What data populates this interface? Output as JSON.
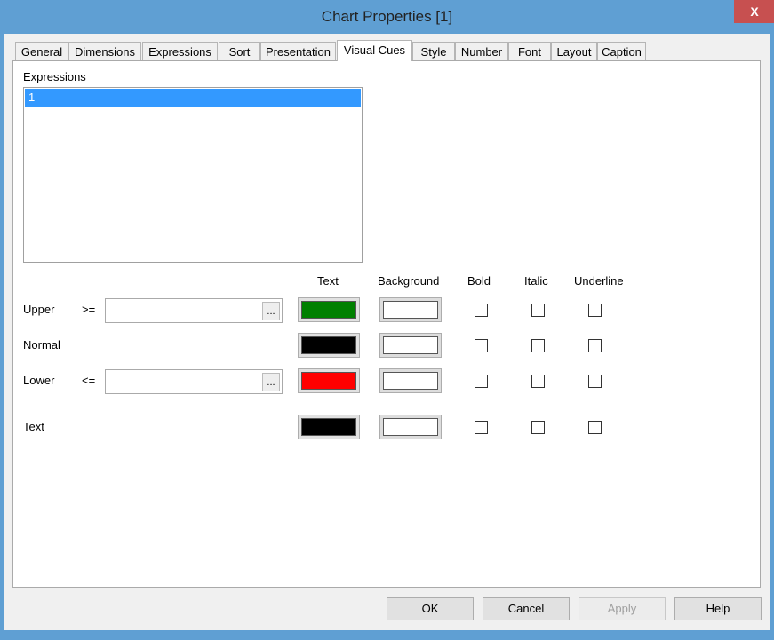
{
  "window": {
    "title": "Chart Properties [1]",
    "close": "X"
  },
  "tabs": [
    "General",
    "Dimensions",
    "Expressions",
    "Sort",
    "Presentation",
    "Visual Cues",
    "Style",
    "Number",
    "Font",
    "Layout",
    "Caption"
  ],
  "selected_tab": "Visual Cues",
  "expressions": {
    "label": "Expressions",
    "items": [
      "1"
    ]
  },
  "columns": {
    "text": "Text",
    "background": "Background",
    "bold": "Bold",
    "italic": "Italic",
    "underline": "Underline"
  },
  "rows": [
    {
      "label": "Upper",
      "op": ">=",
      "value": "",
      "browse": "...",
      "text_color": "#008000",
      "bg_color": "#ffffff",
      "bold": false,
      "italic": false,
      "underline": false
    },
    {
      "label": "Normal",
      "text_color": "#000000",
      "bg_color": "#ffffff",
      "bold": false,
      "italic": false,
      "underline": false
    },
    {
      "label": "Lower",
      "op": "<=",
      "value": "",
      "browse": "...",
      "text_color": "#ff0000",
      "bg_color": "#ffffff",
      "bold": false,
      "italic": false,
      "underline": false
    },
    {
      "label": "Text",
      "text_color": "#000000",
      "bg_color": "#ffffff",
      "bold": false,
      "italic": false,
      "underline": false
    }
  ],
  "buttons": {
    "ok": "OK",
    "cancel": "Cancel",
    "apply": "Apply",
    "help": "Help"
  }
}
